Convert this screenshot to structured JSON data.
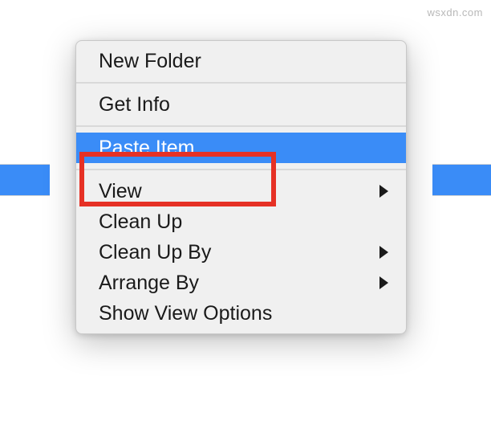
{
  "watermark": "wsxdn.com",
  "menu": {
    "groups": [
      [
        {
          "label": "New Folder",
          "hasSubmenu": false,
          "highlighted": false
        }
      ],
      [
        {
          "label": "Get Info",
          "hasSubmenu": false,
          "highlighted": false
        }
      ],
      [
        {
          "label": "Paste Item",
          "hasSubmenu": false,
          "highlighted": true
        }
      ],
      [
        {
          "label": "View",
          "hasSubmenu": true,
          "highlighted": false
        },
        {
          "label": "Clean Up",
          "hasSubmenu": false,
          "highlighted": false
        },
        {
          "label": "Clean Up By",
          "hasSubmenu": true,
          "highlighted": false
        },
        {
          "label": "Arrange By",
          "hasSubmenu": true,
          "highlighted": false
        },
        {
          "label": "Show View Options",
          "hasSubmenu": false,
          "highlighted": false
        }
      ]
    ]
  }
}
